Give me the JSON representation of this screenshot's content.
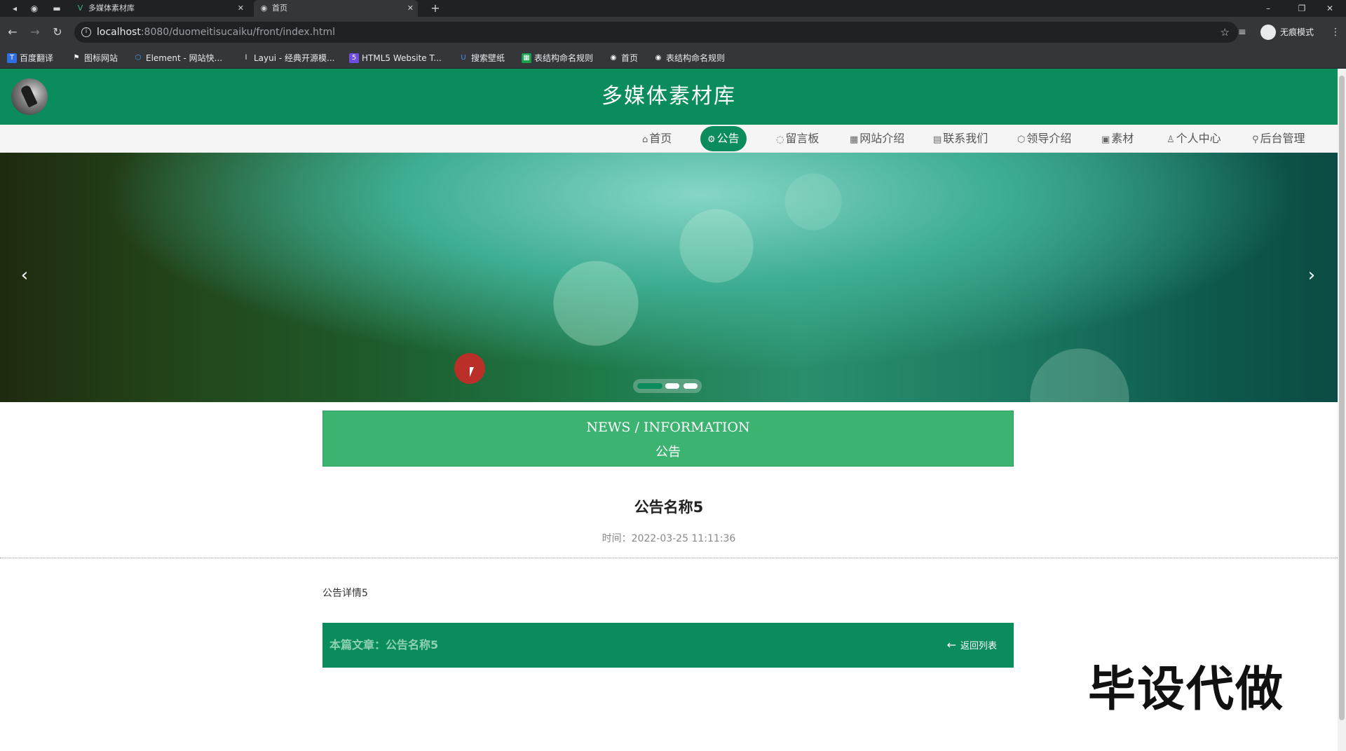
{
  "browser": {
    "tabs": [
      {
        "title": "多媒体素材库",
        "icon": "vue-icon",
        "active": false
      },
      {
        "title": "首页",
        "icon": "globe-icon",
        "active": true
      }
    ],
    "new_tab": "+",
    "url_host": "localhost",
    "url_rest": ":8080/duomeitisucaiku/front/index.html",
    "profile_label": "无痕模式",
    "bookmarks": [
      {
        "label": "百度翻译",
        "icon": "translate-icon"
      },
      {
        "label": "图标网站",
        "icon": "flag-icon"
      },
      {
        "label": "Element - 网站快...",
        "icon": "element-icon"
      },
      {
        "label": "Layui - 经典开源模...",
        "icon": "layui-icon"
      },
      {
        "label": "HTML5 Website T...",
        "icon": "html5-icon"
      },
      {
        "label": "搜索壁纸",
        "icon": "wallpaper-icon"
      },
      {
        "label": "表结构命名规则",
        "icon": "sheet-icon"
      },
      {
        "label": "首页",
        "icon": "globe-icon"
      },
      {
        "label": "表结构命名规则",
        "icon": "globe-icon"
      }
    ]
  },
  "site": {
    "title": "多媒体素材库",
    "accent_color": "#0a8c5c",
    "menu": [
      {
        "label": "首页",
        "icon": "home-icon"
      },
      {
        "label": "公告",
        "icon": "notice-icon",
        "active": true
      },
      {
        "label": "留言板",
        "icon": "message-icon"
      },
      {
        "label": "网站介绍",
        "icon": "grid-icon"
      },
      {
        "label": "联系我们",
        "icon": "contact-icon"
      },
      {
        "label": "领导介绍",
        "icon": "leader-icon"
      },
      {
        "label": "素材",
        "icon": "media-icon"
      },
      {
        "label": "个人中心",
        "icon": "user-icon"
      },
      {
        "label": "后台管理",
        "icon": "link-icon"
      }
    ]
  },
  "banner": {
    "prev": "‹",
    "next": "›",
    "slide_count": 3,
    "active_slide": 1
  },
  "section": {
    "en": "NEWS / INFORMATION",
    "cn": "公告"
  },
  "article": {
    "title": "公告名称5",
    "time": "时间：2022-03-25 11:11:36",
    "body": "公告详情5",
    "current_label": "本篇文章：公告名称5",
    "back_label": "返回列表"
  },
  "watermark": "毕设代做"
}
